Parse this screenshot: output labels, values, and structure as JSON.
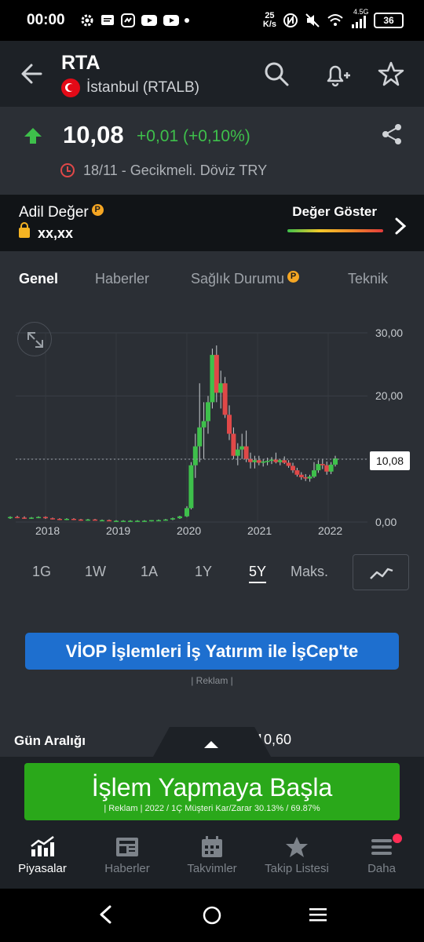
{
  "status_bar": {
    "time": "00:00",
    "net_speed_value": "25",
    "net_speed_unit": "K/s",
    "network_type": "4.5G",
    "battery": "36"
  },
  "header": {
    "ticker": "RTA",
    "exchange": "İstanbul (RTALB)"
  },
  "quote": {
    "price": "10,08",
    "change": "+0,01 (+0,10%)",
    "timestamp": "18/11 - Gecikmeli. Döviz TRY",
    "change_color": "#3ec04b"
  },
  "fair_value": {
    "label": "Adil Değer",
    "pro_badge": "P",
    "value": "xx,xx",
    "show_label": "Değer Göster"
  },
  "tabs": [
    {
      "label": "Genel",
      "active": true
    },
    {
      "label": "Haberler",
      "active": false
    },
    {
      "label": "Sağlık Durumu",
      "active": false
    },
    {
      "label": "Teknik",
      "active": false
    }
  ],
  "chart_data": {
    "type": "candlestick",
    "x_tick_labels": [
      "2018",
      "2019",
      "2020",
      "2021",
      "2022"
    ],
    "y_tick_labels": [
      "30,00",
      "20,00",
      "0,00"
    ],
    "last_price_label": "10,08",
    "ylim": [
      0,
      30
    ],
    "grid": true,
    "candles": [
      {
        "t": 2017.5,
        "o": 0.6,
        "h": 0.9,
        "l": 0.5,
        "c": 0.8
      },
      {
        "t": 2017.6,
        "o": 0.8,
        "h": 1.0,
        "l": 0.6,
        "c": 0.7
      },
      {
        "t": 2017.7,
        "o": 0.7,
        "h": 0.9,
        "l": 0.5,
        "c": 0.6
      },
      {
        "t": 2017.8,
        "o": 0.6,
        "h": 0.8,
        "l": 0.5,
        "c": 0.7
      },
      {
        "t": 2017.9,
        "o": 0.7,
        "h": 0.9,
        "l": 0.6,
        "c": 0.8
      },
      {
        "t": 2018.0,
        "o": 0.8,
        "h": 0.9,
        "l": 0.5,
        "c": 0.6
      },
      {
        "t": 2018.1,
        "o": 0.6,
        "h": 0.7,
        "l": 0.4,
        "c": 0.5
      },
      {
        "t": 2018.2,
        "o": 0.5,
        "h": 0.6,
        "l": 0.3,
        "c": 0.4
      },
      {
        "t": 2018.3,
        "o": 0.4,
        "h": 0.6,
        "l": 0.3,
        "c": 0.5
      },
      {
        "t": 2018.4,
        "o": 0.5,
        "h": 0.6,
        "l": 0.3,
        "c": 0.4
      },
      {
        "t": 2018.5,
        "o": 0.4,
        "h": 0.5,
        "l": 0.2,
        "c": 0.3
      },
      {
        "t": 2018.6,
        "o": 0.3,
        "h": 0.5,
        "l": 0.2,
        "c": 0.4
      },
      {
        "t": 2018.7,
        "o": 0.4,
        "h": 0.5,
        "l": 0.3,
        "c": 0.3
      },
      {
        "t": 2018.8,
        "o": 0.3,
        "h": 0.4,
        "l": 0.2,
        "c": 0.3
      },
      {
        "t": 2018.9,
        "o": 0.3,
        "h": 0.4,
        "l": 0.2,
        "c": 0.2
      },
      {
        "t": 2019.0,
        "o": 0.2,
        "h": 0.3,
        "l": 0.1,
        "c": 0.2
      },
      {
        "t": 2019.1,
        "o": 0.2,
        "h": 0.3,
        "l": 0.1,
        "c": 0.2
      },
      {
        "t": 2019.2,
        "o": 0.2,
        "h": 0.3,
        "l": 0.1,
        "c": 0.2
      },
      {
        "t": 2019.3,
        "o": 0.2,
        "h": 0.3,
        "l": 0.1,
        "c": 0.2
      },
      {
        "t": 2019.4,
        "o": 0.2,
        "h": 0.3,
        "l": 0.1,
        "c": 0.2
      },
      {
        "t": 2019.5,
        "o": 0.2,
        "h": 0.3,
        "l": 0.1,
        "c": 0.3
      },
      {
        "t": 2019.6,
        "o": 0.3,
        "h": 0.4,
        "l": 0.2,
        "c": 0.3
      },
      {
        "t": 2019.7,
        "o": 0.3,
        "h": 0.5,
        "l": 0.2,
        "c": 0.4
      },
      {
        "t": 2019.8,
        "o": 0.4,
        "h": 0.7,
        "l": 0.3,
        "c": 0.6
      },
      {
        "t": 2019.9,
        "o": 0.6,
        "h": 1.0,
        "l": 0.5,
        "c": 0.9
      },
      {
        "t": 2020.0,
        "o": 0.9,
        "h": 2.5,
        "l": 0.8,
        "c": 2.2
      },
      {
        "t": 2020.06,
        "o": 2.2,
        "h": 9.5,
        "l": 2.0,
        "c": 9.0
      },
      {
        "t": 2020.12,
        "o": 9.0,
        "h": 14.0,
        "l": 7.0,
        "c": 12.0
      },
      {
        "t": 2020.18,
        "o": 12.0,
        "h": 22.0,
        "l": 9.5,
        "c": 15.0
      },
      {
        "t": 2020.24,
        "o": 15.0,
        "h": 19.0,
        "l": 10.0,
        "c": 16.0
      },
      {
        "t": 2020.3,
        "o": 16.0,
        "h": 20.0,
        "l": 14.0,
        "c": 19.0
      },
      {
        "t": 2020.36,
        "o": 19.0,
        "h": 27.5,
        "l": 18.0,
        "c": 26.5
      },
      {
        "t": 2020.42,
        "o": 26.5,
        "h": 28.0,
        "l": 19.0,
        "c": 20.5
      },
      {
        "t": 2020.48,
        "o": 20.5,
        "h": 24.0,
        "l": 18.0,
        "c": 22.0
      },
      {
        "t": 2020.54,
        "o": 22.0,
        "h": 23.0,
        "l": 16.5,
        "c": 17.0
      },
      {
        "t": 2020.6,
        "o": 17.0,
        "h": 18.5,
        "l": 13.0,
        "c": 14.0
      },
      {
        "t": 2020.66,
        "o": 14.0,
        "h": 15.0,
        "l": 10.0,
        "c": 10.5
      },
      {
        "t": 2020.72,
        "o": 10.5,
        "h": 12.5,
        "l": 9.0,
        "c": 11.5
      },
      {
        "t": 2020.78,
        "o": 11.5,
        "h": 14.0,
        "l": 10.0,
        "c": 12.0
      },
      {
        "t": 2020.84,
        "o": 12.0,
        "h": 14.5,
        "l": 9.5,
        "c": 10.0
      },
      {
        "t": 2020.9,
        "o": 10.0,
        "h": 11.0,
        "l": 8.5,
        "c": 9.5
      },
      {
        "t": 2020.96,
        "o": 9.5,
        "h": 10.5,
        "l": 8.5,
        "c": 9.8
      },
      {
        "t": 2021.02,
        "o": 9.8,
        "h": 10.5,
        "l": 9.0,
        "c": 9.4
      },
      {
        "t": 2021.08,
        "o": 9.4,
        "h": 10.0,
        "l": 8.8,
        "c": 9.6
      },
      {
        "t": 2021.14,
        "o": 9.6,
        "h": 10.2,
        "l": 9.0,
        "c": 9.7
      },
      {
        "t": 2021.2,
        "o": 9.7,
        "h": 10.3,
        "l": 9.2,
        "c": 9.9
      },
      {
        "t": 2021.26,
        "o": 9.9,
        "h": 11.0,
        "l": 9.3,
        "c": 9.5
      },
      {
        "t": 2021.32,
        "o": 9.5,
        "h": 10.0,
        "l": 9.0,
        "c": 9.8
      },
      {
        "t": 2021.38,
        "o": 9.8,
        "h": 10.4,
        "l": 9.2,
        "c": 9.4
      },
      {
        "t": 2021.44,
        "o": 9.4,
        "h": 9.8,
        "l": 8.6,
        "c": 8.9
      },
      {
        "t": 2021.5,
        "o": 8.9,
        "h": 9.4,
        "l": 7.8,
        "c": 8.2
      },
      {
        "t": 2021.56,
        "o": 8.2,
        "h": 8.6,
        "l": 7.2,
        "c": 7.5
      },
      {
        "t": 2021.62,
        "o": 7.5,
        "h": 7.9,
        "l": 6.7,
        "c": 7.1
      },
      {
        "t": 2021.68,
        "o": 7.1,
        "h": 7.6,
        "l": 6.5,
        "c": 6.9
      },
      {
        "t": 2021.74,
        "o": 6.9,
        "h": 7.5,
        "l": 6.4,
        "c": 7.2
      },
      {
        "t": 2021.8,
        "o": 7.2,
        "h": 9.5,
        "l": 7.0,
        "c": 8.2
      },
      {
        "t": 2021.86,
        "o": 8.2,
        "h": 9.8,
        "l": 7.8,
        "c": 9.2
      },
      {
        "t": 2021.92,
        "o": 9.2,
        "h": 10.0,
        "l": 8.4,
        "c": 9.0
      },
      {
        "t": 2021.98,
        "o": 9.0,
        "h": 9.6,
        "l": 7.5,
        "c": 8.0
      },
      {
        "t": 2022.04,
        "o": 8.0,
        "h": 9.5,
        "l": 7.6,
        "c": 9.1
      },
      {
        "t": 2022.1,
        "o": 9.1,
        "h": 10.5,
        "l": 8.8,
        "c": 10.08
      }
    ]
  },
  "ranges": [
    {
      "label": "1G",
      "active": false
    },
    {
      "label": "1W",
      "active": false
    },
    {
      "label": "1A",
      "active": false
    },
    {
      "label": "1Y",
      "active": false
    },
    {
      "label": "5Y",
      "active": true
    },
    {
      "label": "Maks.",
      "active": false
    }
  ],
  "ad": {
    "button_label": "VİOP İşlemleri İş Yatırım ile İşCep'te",
    "note": "| Reklam |"
  },
  "day_range": {
    "label": "Gün Aralığı",
    "value": "10,60"
  },
  "cta": {
    "title": "İşlem Yapmaya Başla",
    "note": "| Reklam | 2022 / 1Ç Müşteri Kar/Zarar 30.13% / 69.87%"
  },
  "bottom_nav": [
    {
      "label": "Piyasalar",
      "icon": "chart-trend-icon",
      "active": true
    },
    {
      "label": "Haberler",
      "icon": "news-icon",
      "active": false
    },
    {
      "label": "Takvimler",
      "icon": "calendar-icon",
      "active": false
    },
    {
      "label": "Takip Listesi",
      "icon": "star-icon",
      "active": false
    },
    {
      "label": "Daha",
      "icon": "menu-icon",
      "active": false
    }
  ],
  "colors": {
    "up": "#3ec04b",
    "down": "#e04848",
    "background": "#2b2f35",
    "ad_blue": "#1e6fcf",
    "cta_green": "#2aa81a"
  }
}
